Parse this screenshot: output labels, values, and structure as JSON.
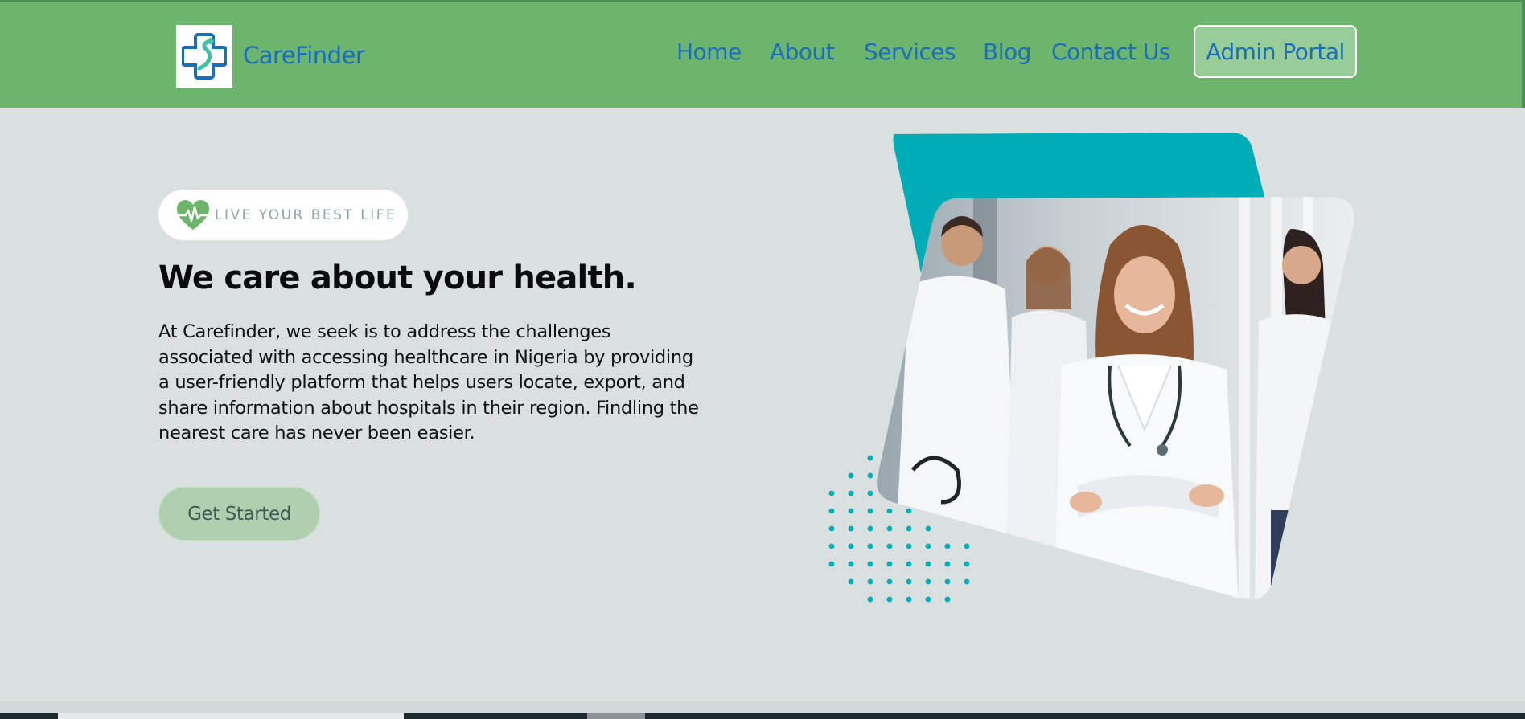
{
  "header": {
    "brand": "CareFinder",
    "nav": [
      "Home",
      "About",
      "Services",
      "Blog",
      "Contact Us"
    ],
    "admin_button": "Admin Portal"
  },
  "hero": {
    "badge_icon": "heart-pulse-icon",
    "badge_text": "LIVE YOUR BEST LIFE",
    "headline": "We care about your health.",
    "intro": "At Carefinder, we seek is to address the challenges associated with accessing healthcare in Nigeria by providing a user-friendly platform that helps users locate, export, and share information about hospitals in their region. Findling the nearest care has never been easier.",
    "cta": "Get Started"
  },
  "colors": {
    "navbar": "#6db56d",
    "brand_text": "#1a6fba",
    "teal_accent": "#00acb5",
    "page_bg": "#dadfdf"
  }
}
